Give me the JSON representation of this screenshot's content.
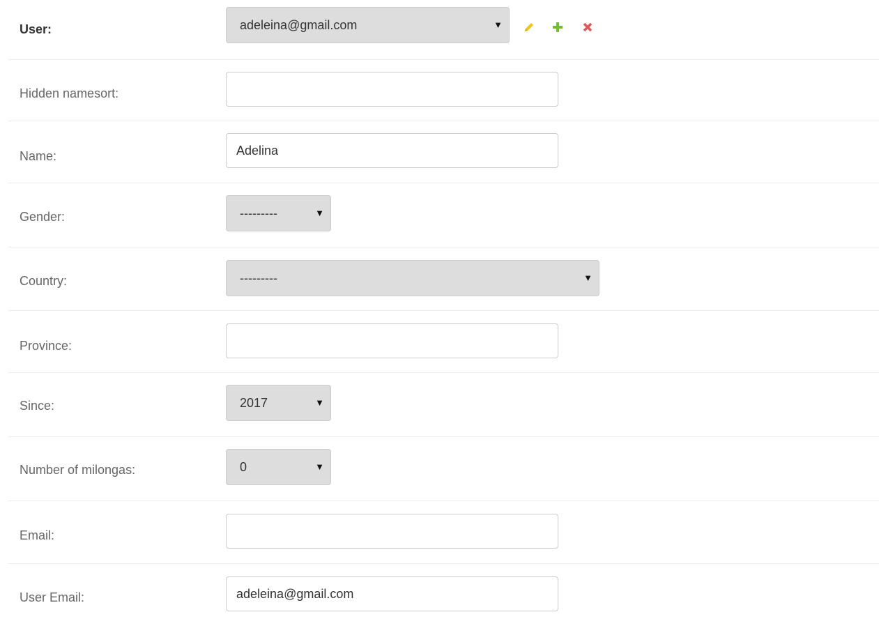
{
  "fields": {
    "user": {
      "label": "User:",
      "selected": "adeleina@gmail.com",
      "caret": "▼",
      "actions": {
        "edit_icon": "pencil-icon",
        "add_icon": "plus-icon",
        "delete_icon": "close-icon"
      }
    },
    "hidden_namesort": {
      "label": "Hidden namesort:",
      "value": ""
    },
    "name": {
      "label": "Name:",
      "value": "Adelina"
    },
    "gender": {
      "label": "Gender:",
      "selected": "---------",
      "caret": "▼"
    },
    "country": {
      "label": "Country:",
      "selected": "---------",
      "caret": "▼"
    },
    "province": {
      "label": "Province:",
      "value": ""
    },
    "since": {
      "label": "Since:",
      "selected": "2017",
      "caret": "▼"
    },
    "number_of_milongas": {
      "label": "Number of milongas:",
      "selected": "0",
      "caret": "▼"
    },
    "email": {
      "label": "Email:",
      "value": ""
    },
    "user_email": {
      "label": "User Email:",
      "value": "adeleina@gmail.com"
    }
  },
  "colors": {
    "edit_icon": "#f0c419",
    "add_icon": "#70bf2b",
    "delete_icon": "#e65555",
    "select_bg": "#dddddd",
    "row_border": "#eeeeee"
  }
}
